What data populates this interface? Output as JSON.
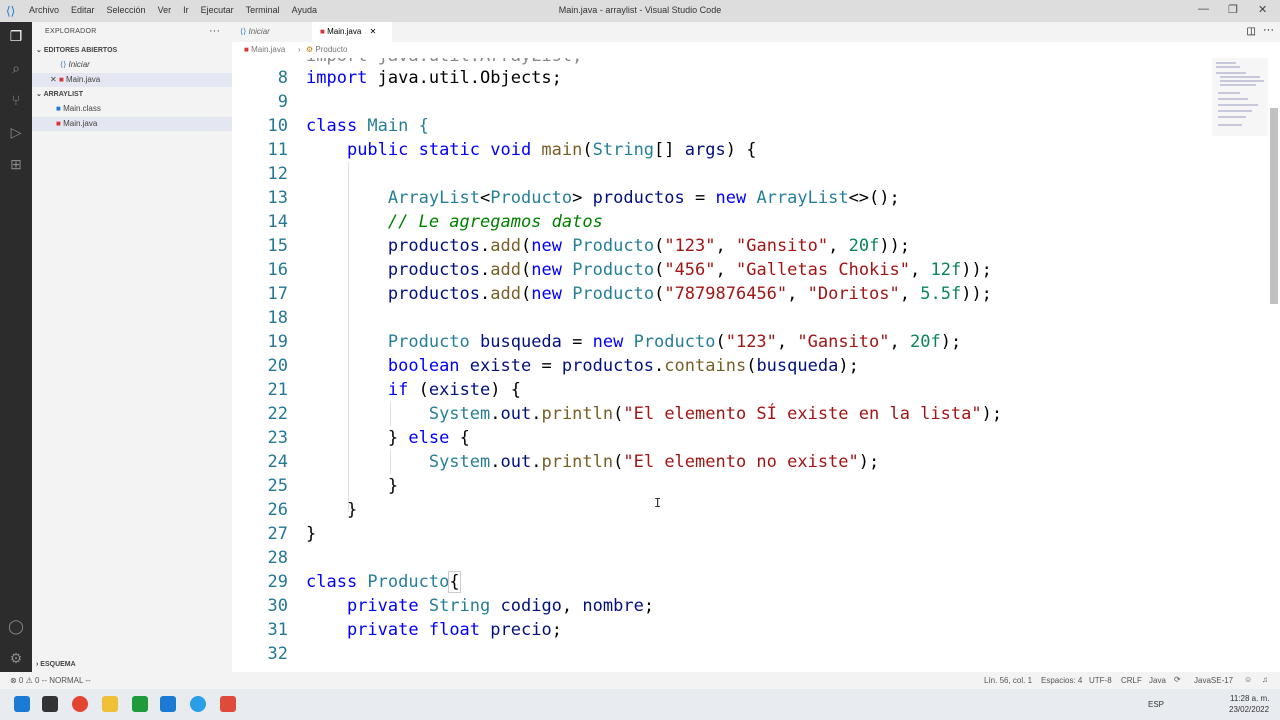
{
  "window": {
    "title": "Main.java - arraylist - Visual Studio Code"
  },
  "menu": [
    "Archivo",
    "Editar",
    "Selección",
    "Ver",
    "Ir",
    "Ejecutar",
    "Terminal",
    "Ayuda"
  ],
  "sidebar": {
    "title": "EXPLORADOR",
    "open_editors": {
      "label": "EDITORES ABIERTOS",
      "items": [
        "Iniciar",
        "Main.java"
      ]
    },
    "project": {
      "label": "ARRAYLIST",
      "items": [
        "Main.class",
        "Main.java"
      ]
    },
    "outline": "ESQUEMA"
  },
  "tabs": [
    {
      "label": "Iniciar"
    },
    {
      "label": "Main.java",
      "active": true
    }
  ],
  "breadcrumb": {
    "file": "Main.java",
    "symbol": "Producto"
  },
  "editor": {
    "lines": [
      {
        "n": "8"
      },
      {
        "n": "9"
      },
      {
        "n": "10"
      },
      {
        "n": "11"
      },
      {
        "n": "12"
      },
      {
        "n": "13"
      },
      {
        "n": "14"
      },
      {
        "n": "15"
      },
      {
        "n": "16"
      },
      {
        "n": "17"
      },
      {
        "n": "18"
      },
      {
        "n": "19"
      },
      {
        "n": "20"
      },
      {
        "n": "21"
      },
      {
        "n": "22"
      },
      {
        "n": "23"
      },
      {
        "n": "24"
      },
      {
        "n": "25"
      },
      {
        "n": "26"
      },
      {
        "n": "27"
      },
      {
        "n": "28"
      },
      {
        "n": "29"
      },
      {
        "n": "30"
      },
      {
        "n": "31"
      },
      {
        "n": "32"
      }
    ],
    "code": {
      "l8a": "import ",
      "l8b": "java.util.Objects;",
      "l10a": "class ",
      "l10b": "Main {",
      "l11a": "public static void ",
      "l11b": "main",
      "l11c": "(",
      "l11d": "String",
      "l11e": "[] ",
      "l11f": "args",
      ") {": ") {",
      "l13a": "ArrayList",
      "l13b": "<",
      "l13c": "Producto",
      "l13d": "> ",
      "l13e": "productos",
      " = ": " = ",
      "l13g": "new ",
      "l13h": "ArrayList",
      "l13i": "<>();",
      "l14": "// Le agregamos datos",
      "l15": [
        "productos",
        ".",
        "add",
        "(",
        "new ",
        "Producto",
        "(",
        "\"123\"",
        ", ",
        "\"Gansito\"",
        ", ",
        "20f",
        "));"
      ],
      "l16": [
        "productos",
        ".",
        "add",
        "(",
        "new ",
        "Producto",
        "(",
        "\"456\"",
        ", ",
        "\"Galletas Chokis\"",
        ", ",
        "12f",
        "));"
      ],
      "l17": [
        "productos",
        ".",
        "add",
        "(",
        "new ",
        "Producto",
        "(",
        "\"7879876456\"",
        ", ",
        "\"Doritos\"",
        ", ",
        "5.5f",
        "));"
      ],
      "l19": [
        "Producto ",
        "busqueda",
        " = ",
        "new ",
        "Producto",
        "(",
        "\"123\"",
        ", ",
        "\"Gansito\"",
        ", ",
        "20f",
        ");"
      ],
      "l20": [
        "boolean ",
        "existe",
        " = ",
        "productos",
        ".",
        "contains",
        "(",
        "busqueda",
        ");"
      ],
      "l21": [
        "if ",
        "(",
        "existe",
        ") {"
      ],
      "l22": [
        "System",
        ".",
        "out",
        ".",
        "println",
        "(",
        "\"El elemento SÍ existe en la lista\"",
        ");"
      ],
      "l23": [
        "} ",
        "else ",
        "{"
      ],
      "l24": [
        "System",
        ".",
        "out",
        ".",
        "println",
        "(",
        "\"El elemento no existe\"",
        ");"
      ],
      "l25": "}",
      "l26": "}",
      "l27": "}",
      "l29a": "class ",
      "l29b": "Producto",
      "l29c": "{",
      "l30": [
        "private ",
        "String ",
        "codigo",
        ", ",
        "nombre",
        ";"
      ],
      "l31": [
        "private ",
        "float ",
        "precio",
        ";"
      ]
    }
  },
  "status": {
    "left": "⊗ 0  ⚠ 0    -- NORMAL --",
    "pos": "Lín. 56, col. 1",
    "spaces": "Espacios: 4",
    "enc": "UTF-8",
    "eol": "CRLF",
    "lang": "Java",
    "jdk": "JavaSE-17"
  },
  "taskbar": {
    "lang": "ESP",
    "time": "11:28 a. m.",
    "date": "23/02/2022"
  }
}
